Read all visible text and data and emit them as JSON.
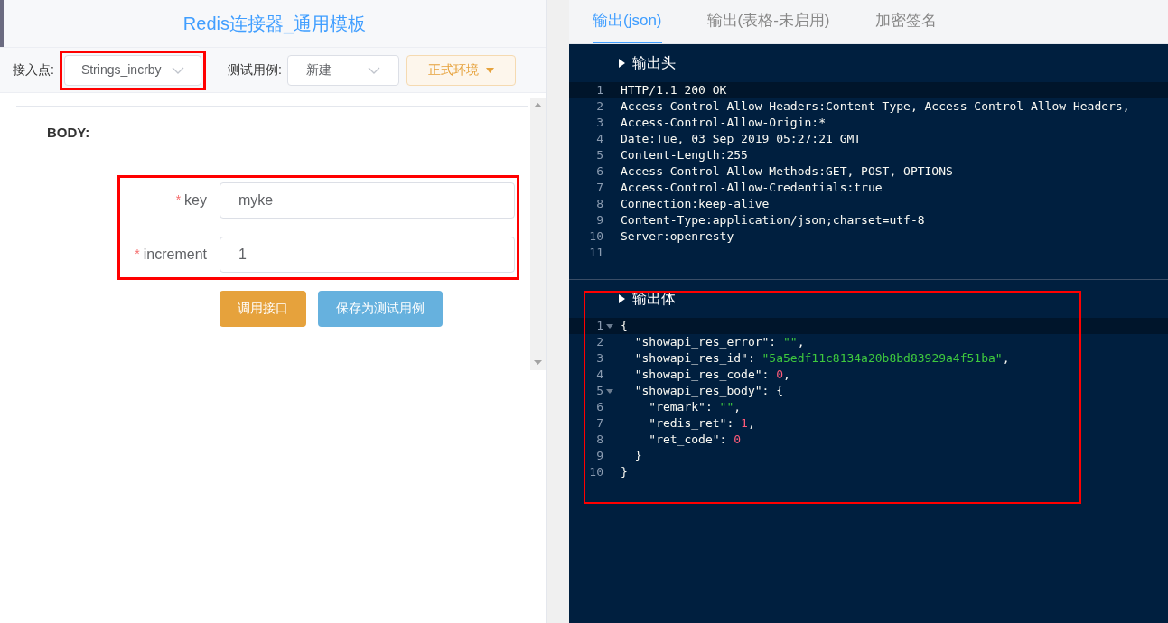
{
  "left": {
    "title": "Redis连接器_通用模板",
    "toolbar": {
      "endpoint": {
        "label": "接入点:",
        "value": "Strings_incrby",
        "highlighted": true
      },
      "test_case": {
        "label": "测试用例:",
        "value": "新建"
      },
      "env_button": "正式环境"
    },
    "body": {
      "heading": "BODY:",
      "fields_highlighted": true,
      "fields": [
        {
          "label": "key",
          "required_mark": "*",
          "value": "myke"
        },
        {
          "label": "increment",
          "required_mark": "*",
          "value": "1"
        }
      ],
      "buttons": [
        {
          "label": "调用接口",
          "kind": "primary"
        },
        {
          "label": "保存为测试用例",
          "kind": "secondary"
        }
      ]
    }
  },
  "right": {
    "tabs": [
      {
        "label": "输出(json)",
        "selected": true
      },
      {
        "label": "输出(表格-未启用)",
        "selected": false
      },
      {
        "label": "加密签名",
        "selected": false
      }
    ],
    "sections": [
      {
        "title": "输出头",
        "highlighted": false,
        "lines": [
          {
            "number": "1",
            "current": true,
            "foldable": false,
            "tokens": [
              {
                "kind": "plain",
                "text": "HTTP/1.1 200 OK"
              }
            ]
          },
          {
            "number": "2",
            "current": false,
            "foldable": false,
            "tokens": [
              {
                "kind": "plain",
                "text": "Access-Control-Allow-Headers:Content-Type, Access-Control-Allow-Headers,"
              }
            ]
          },
          {
            "number": "3",
            "current": false,
            "foldable": false,
            "tokens": [
              {
                "kind": "plain",
                "text": "Access-Control-Allow-Origin:*"
              }
            ]
          },
          {
            "number": "4",
            "current": false,
            "foldable": false,
            "tokens": [
              {
                "kind": "plain",
                "text": "Date:Tue, 03 Sep 2019 05:27:21 GMT"
              }
            ]
          },
          {
            "number": "5",
            "current": false,
            "foldable": false,
            "tokens": [
              {
                "kind": "plain",
                "text": "Content-Length:255"
              }
            ]
          },
          {
            "number": "6",
            "current": false,
            "foldable": false,
            "tokens": [
              {
                "kind": "plain",
                "text": "Access-Control-Allow-Methods:GET, POST, OPTIONS"
              }
            ]
          },
          {
            "number": "7",
            "current": false,
            "foldable": false,
            "tokens": [
              {
                "kind": "plain",
                "text": "Access-Control-Allow-Credentials:true"
              }
            ]
          },
          {
            "number": "8",
            "current": false,
            "foldable": false,
            "tokens": [
              {
                "kind": "plain",
                "text": "Connection:keep-alive"
              }
            ]
          },
          {
            "number": "9",
            "current": false,
            "foldable": false,
            "tokens": [
              {
                "kind": "plain",
                "text": "Content-Type:application/json;charset=utf-8"
              }
            ]
          },
          {
            "number": "10",
            "current": false,
            "foldable": false,
            "tokens": [
              {
                "kind": "plain",
                "text": "Server:openresty"
              }
            ]
          },
          {
            "number": "11",
            "current": false,
            "foldable": false
          }
        ]
      },
      {
        "title": "输出体",
        "highlighted": true,
        "lines": [
          {
            "number": "1",
            "current": true,
            "foldable": true,
            "tokens": [
              {
                "kind": "plain",
                "text": "{"
              }
            ]
          },
          {
            "number": "2",
            "current": false,
            "foldable": false,
            "tokens": [
              {
                "kind": "plain",
                "text": "  \"showapi_res_error\": "
              },
              {
                "kind": "string",
                "text": "\"\""
              },
              {
                "kind": "plain",
                "text": ","
              }
            ]
          },
          {
            "number": "3",
            "current": false,
            "foldable": false,
            "tokens": [
              {
                "kind": "plain",
                "text": "  \"showapi_res_id\": "
              },
              {
                "kind": "string",
                "text": "\"5a5edf11c8134a20b8bd83929a4f51ba\""
              },
              {
                "kind": "plain",
                "text": ","
              }
            ]
          },
          {
            "number": "4",
            "current": false,
            "foldable": false,
            "tokens": [
              {
                "kind": "plain",
                "text": "  \"showapi_res_code\": "
              },
              {
                "kind": "number",
                "text": "0"
              },
              {
                "kind": "plain",
                "text": ","
              }
            ]
          },
          {
            "number": "5",
            "current": false,
            "foldable": true,
            "tokens": [
              {
                "kind": "plain",
                "text": "  \"showapi_res_body\": {"
              }
            ]
          },
          {
            "number": "6",
            "current": false,
            "foldable": false,
            "tokens": [
              {
                "kind": "plain",
                "text": "    \"remark\": "
              },
              {
                "kind": "string",
                "text": "\"\""
              },
              {
                "kind": "plain",
                "text": ","
              }
            ]
          },
          {
            "number": "7",
            "current": false,
            "foldable": false,
            "tokens": [
              {
                "kind": "plain",
                "text": "    \"redis_ret\": "
              },
              {
                "kind": "number",
                "text": "1"
              },
              {
                "kind": "plain",
                "text": ","
              }
            ]
          },
          {
            "number": "8",
            "current": false,
            "foldable": false,
            "tokens": [
              {
                "kind": "plain",
                "text": "    \"ret_code\": "
              },
              {
                "kind": "number",
                "text": "0"
              }
            ]
          },
          {
            "number": "9",
            "current": false,
            "foldable": false,
            "tokens": [
              {
                "kind": "plain",
                "text": "  }"
              }
            ]
          },
          {
            "number": "10",
            "current": false,
            "foldable": false,
            "tokens": [
              {
                "kind": "plain",
                "text": "}"
              }
            ]
          }
        ]
      }
    ]
  }
}
